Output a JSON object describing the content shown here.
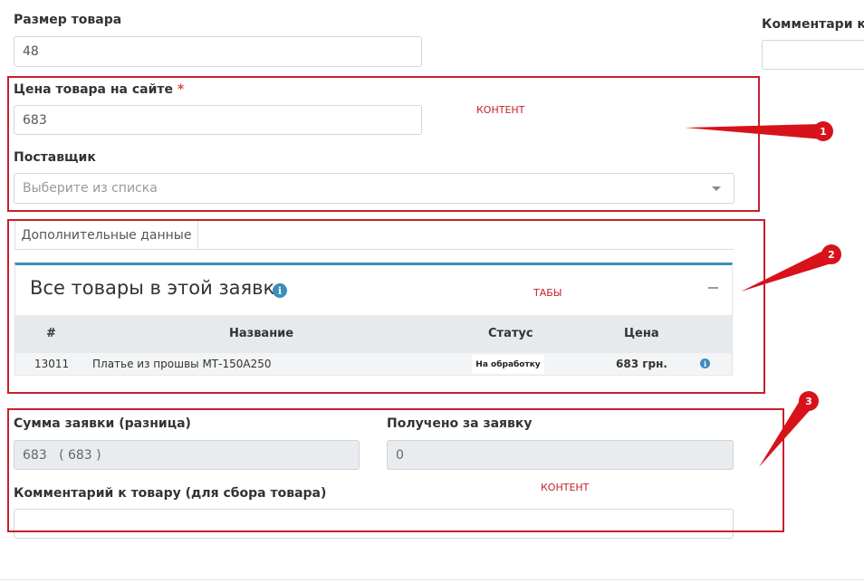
{
  "form": {
    "size": {
      "label": "Размер товара",
      "value": "48"
    },
    "comment_right": {
      "label": "Комментари к т"
    },
    "price": {
      "label": "Цена товара на сайте",
      "required_mark": "*",
      "value": "683"
    },
    "supplier": {
      "label": "Поставщик",
      "placeholder": "Выберите из списка"
    },
    "tabs": [
      {
        "label": "Дополнительные данные"
      }
    ],
    "order_sum": {
      "label": "Сумма заявки (разница)",
      "value": "683   ( 683 )"
    },
    "received": {
      "label": "Получено за заявку",
      "value": "0"
    },
    "item_comment": {
      "label": "Комментарий к товару (для сбора товара)",
      "value": ""
    }
  },
  "card": {
    "title": "Все товары в этой заявке",
    "columns": [
      "#",
      "Название",
      "Статус",
      "Цена"
    ],
    "rows": [
      {
        "id": "13011",
        "name": "Платье из прошвы МТ-150А250",
        "status": "На обработку",
        "price": "683 грн."
      }
    ]
  },
  "annotations": {
    "box1_label": "КОНТЕНТ",
    "box2_label": "ТАБЫ",
    "box3_label": "КОНТЕНТ",
    "markers": [
      "1",
      "2",
      "3"
    ],
    "color": "#c8202a"
  },
  "colors": {
    "accent": "#3c8dbc",
    "marker": "#d7121b"
  }
}
